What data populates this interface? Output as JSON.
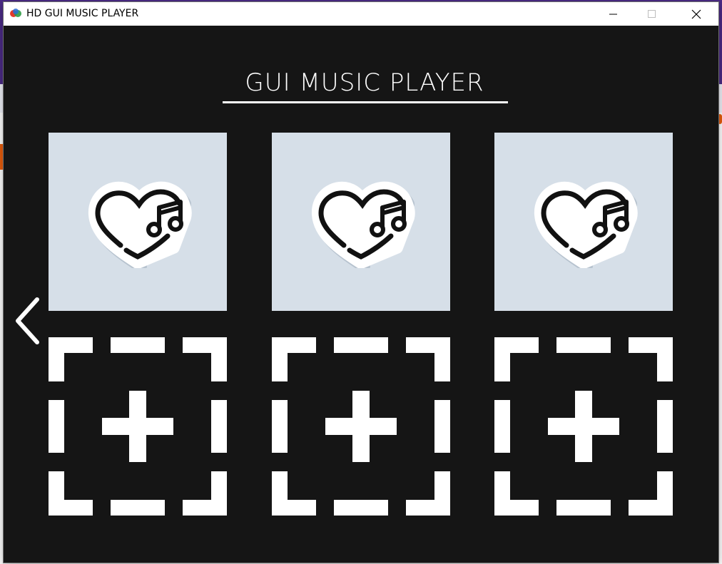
{
  "window": {
    "title": "HD GUI MUSIC PLAYER",
    "controls": [
      "minimize",
      "maximize",
      "close"
    ]
  },
  "player": {
    "heading": "GUI MUSIC PLAYER",
    "nav": {
      "previous_icon": "chevron-left-icon"
    },
    "playlists": [
      {
        "icon": "heart-music-note-icon"
      },
      {
        "icon": "heart-music-note-icon"
      },
      {
        "icon": "heart-music-note-icon"
      }
    ],
    "add_slots": [
      {
        "icon": "add-dashed-plus-icon"
      },
      {
        "icon": "add-dashed-plus-icon"
      },
      {
        "icon": "add-dashed-plus-icon"
      }
    ]
  },
  "colors": {
    "background": "#151515",
    "tile": "#d6dfe8",
    "foreground": "#ffffff",
    "desktop_purple": "#4b2a86"
  }
}
